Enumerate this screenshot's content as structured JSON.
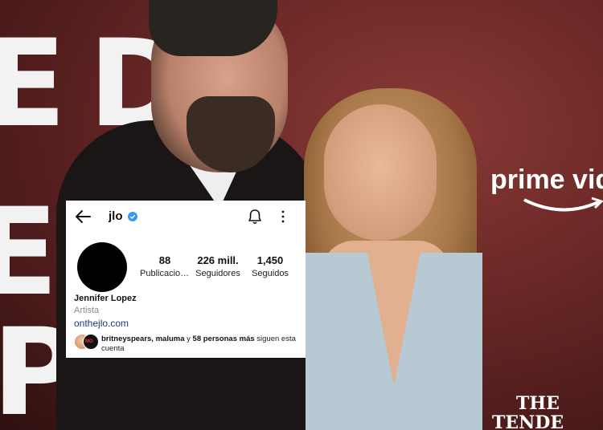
{
  "backdrop": {
    "brand": "prime vid",
    "movie_title": "THE",
    "movie_title_2": "TENDE"
  },
  "profile": {
    "username": "jlo",
    "name": "Jennifer Lopez",
    "category": "Artista",
    "link": "onthejlo.com",
    "stats": {
      "posts_value": "88",
      "posts_label": "Publicaciones",
      "followers_value": "226 mill.",
      "followers_label": "Seguidores",
      "following_value": "1,450",
      "following_label": "Seguidos"
    },
    "followed_by": {
      "names": "britneyspears, maluma",
      "connector": " y ",
      "others": "58 personas más",
      "suffix": " siguen esta cuenta",
      "mini_avatar_2_text": "MO"
    }
  },
  "icons": {
    "back": "arrow-left-icon",
    "verified": "verified-badge-icon",
    "notifications": "bell-icon",
    "more": "more-vertical-icon"
  },
  "colors": {
    "verified_blue": "#3897f0",
    "link_blue": "#1a3a7a",
    "backdrop_red": "#6e2a28"
  }
}
